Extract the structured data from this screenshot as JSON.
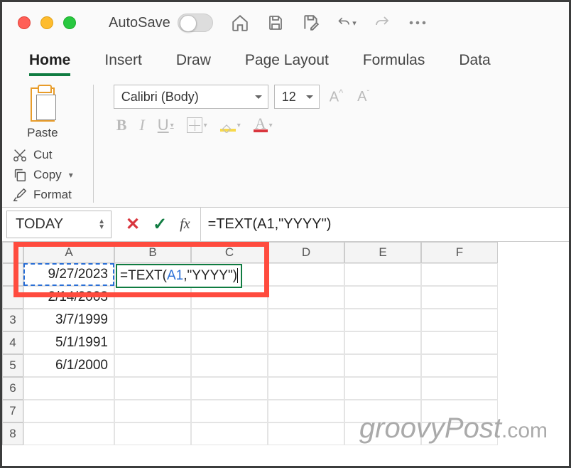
{
  "titlebar": {
    "autosave_label": "AutoSave"
  },
  "tabs": [
    "Home",
    "Insert",
    "Draw",
    "Page Layout",
    "Formulas",
    "Data"
  ],
  "active_tab": 0,
  "clipboard": {
    "paste": "Paste",
    "cut": "Cut",
    "copy": "Copy",
    "format": "Format"
  },
  "font": {
    "name": "Calibri (Body)",
    "size": "12",
    "bold": "B",
    "italic": "I",
    "underline": "U",
    "fontcolor_char": "A"
  },
  "namebox": "TODAY",
  "fx_label": "fx",
  "formula": "=TEXT(A1,\"YYYY\")",
  "columns": [
    "A",
    "B",
    "C",
    "D",
    "E",
    "F"
  ],
  "rows": [
    {
      "num": "",
      "a": "9/27/2023",
      "b_formula": {
        "pre": "=TEXT(",
        "ref": "A1",
        "post": ",\"YYYY\")"
      }
    },
    {
      "num": "",
      "a": "2/14/2003"
    },
    {
      "num": "3",
      "a": "3/7/1999"
    },
    {
      "num": "4",
      "a": "5/1/1991"
    },
    {
      "num": "5",
      "a": "6/1/2000"
    },
    {
      "num": "6",
      "a": ""
    },
    {
      "num": "7",
      "a": ""
    },
    {
      "num": "8",
      "a": ""
    }
  ],
  "watermark": {
    "main": "groovyPost",
    "suffix": ".com"
  }
}
